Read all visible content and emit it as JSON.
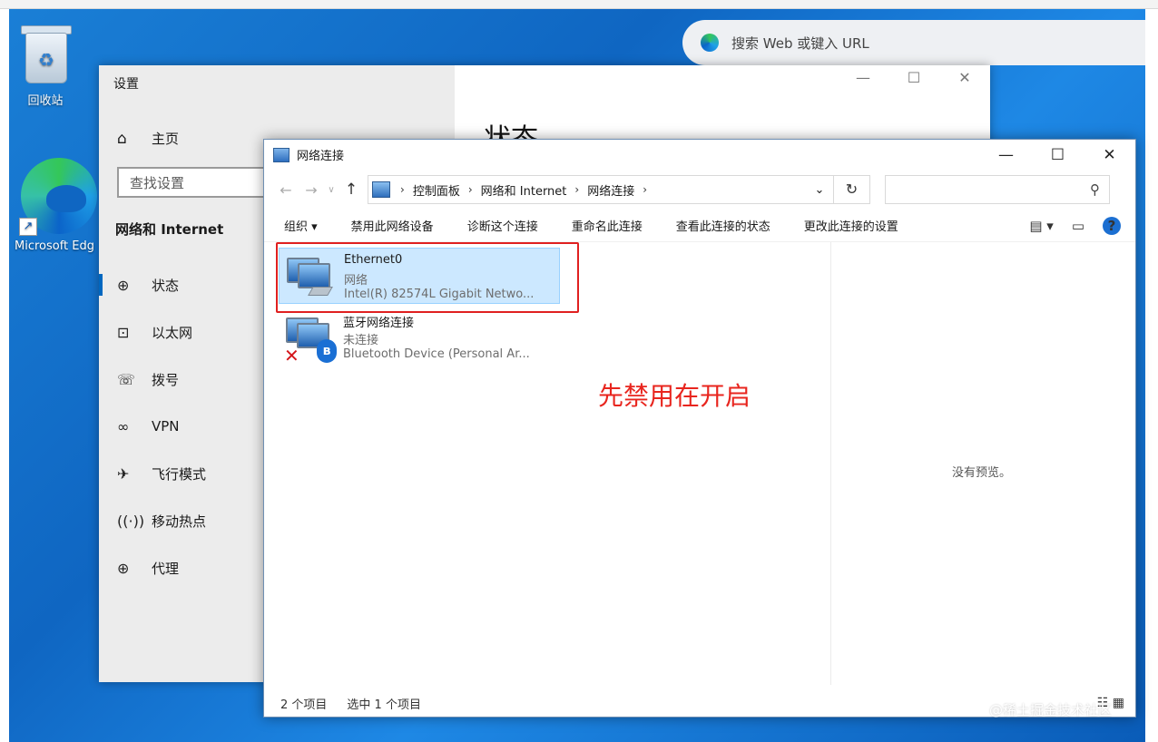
{
  "desktop": {
    "recycle_bin_label": "回收站",
    "edge_label": "Microsoft Edg"
  },
  "browser": {
    "search_placeholder": "搜索 Web 或键入 URL"
  },
  "settings": {
    "window_title": "设置",
    "page_heading": "状态",
    "home_label": "主页",
    "search_placeholder": "查找设置",
    "section_title": "网络和 Internet",
    "nav": [
      {
        "label": "状态",
        "icon": "globe-status-icon",
        "active": true
      },
      {
        "label": "以太网",
        "icon": "ethernet-icon",
        "active": false
      },
      {
        "label": "拨号",
        "icon": "dialup-icon",
        "active": false
      },
      {
        "label": "VPN",
        "icon": "vpn-icon",
        "active": false
      },
      {
        "label": "飞行模式",
        "icon": "airplane-icon",
        "active": false
      },
      {
        "label": "移动热点",
        "icon": "hotspot-icon",
        "active": false
      },
      {
        "label": "代理",
        "icon": "proxy-globe-icon",
        "active": false
      }
    ]
  },
  "explorer": {
    "window_title": "网络连接",
    "breadcrumb": [
      "控制面板",
      "网络和 Internet",
      "网络连接"
    ],
    "commands": [
      "组织 ▾",
      "禁用此网络设备",
      "诊断这个连接",
      "重命名此连接",
      "查看此连接的状态",
      "更改此连接的设置"
    ],
    "items": [
      {
        "name": "Ethernet0",
        "status": "网络",
        "device": "Intel(R) 82574L Gigabit Netwo...",
        "selected": true
      },
      {
        "name": "蓝牙网络连接",
        "status": "未连接",
        "device": "Bluetooth Device (Personal Ar...",
        "selected": false
      }
    ],
    "preview_text": "没有预览。",
    "status_count": "2 个项目",
    "status_selected": "选中 1 个项目"
  },
  "annotation": {
    "note": "先禁用在开启"
  },
  "watermark": "@稀土掘金技术社区",
  "colors": {
    "desktop_blue": "#0f66c2",
    "selection": "#cce8ff",
    "annotation_red": "#e02020",
    "accent": "#0067c0"
  }
}
